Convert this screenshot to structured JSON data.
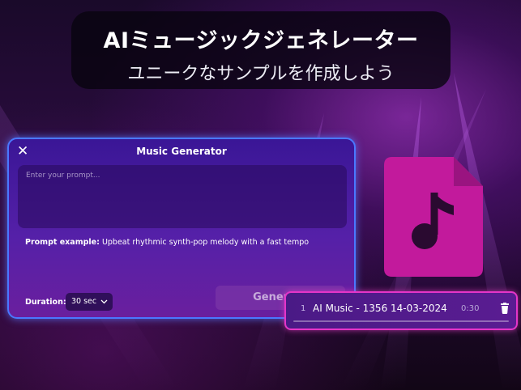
{
  "hero": {
    "title": "AIミュージックジェネレーター",
    "subtitle": "ユニークなサンプルを作成しよう"
  },
  "generator": {
    "title": "Music Generator",
    "close_icon": "close-icon",
    "prompt_placeholder": "Enter your prompt...",
    "prompt_value": "",
    "example_label": "Prompt example:",
    "example_text": "Upbeat rhythmic synth-pop melody with a fast tempo",
    "duration_label": "Duration:",
    "duration_value": "30 sec",
    "generate_label": "Generate"
  },
  "file_icon": "music-file-icon",
  "track": {
    "index": "1",
    "name": "AI Music - 1356 14-03-2024",
    "duration": "0:30",
    "progress": 0
  },
  "colors": {
    "accent_magenta": "#c21a9c",
    "panel_border": "#4a78ff",
    "track_border": "#e535c8"
  }
}
